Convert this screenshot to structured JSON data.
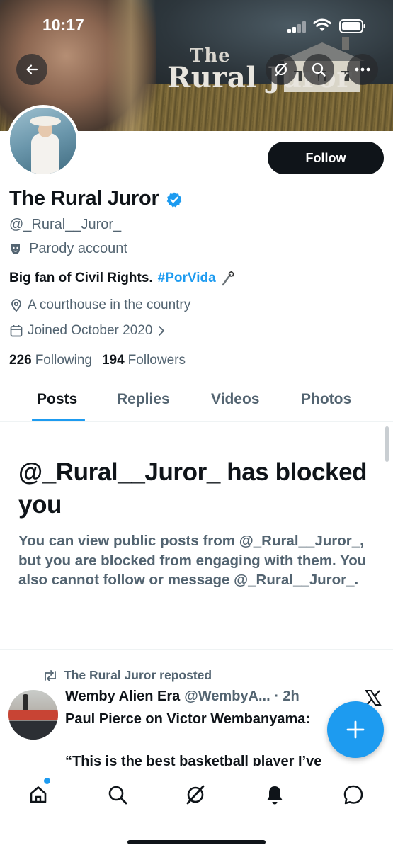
{
  "status_bar": {
    "time": "10:17"
  },
  "banner": {
    "title_line1": "The",
    "title_line2": "Rural Juror"
  },
  "profile": {
    "name": "The Rural Juror",
    "handle": "@_Rural__Juror_",
    "parody_label": "Parody account",
    "bio_text": "Big fan of Civil Rights.",
    "bio_hashtag": "#PorVida",
    "location": "A courthouse in the country",
    "joined": "Joined October 2020",
    "following_count": "226",
    "following_label": "Following",
    "followers_count": "194",
    "followers_label": "Followers",
    "follow_button": "Follow"
  },
  "tabs": [
    "Posts",
    "Replies",
    "Videos",
    "Photos"
  ],
  "blocked": {
    "title": "@_Rural__Juror_ has blocked you",
    "description": "You can view public posts from @_Rural__Juror_, but you are blocked from engaging with them. You also cannot follow or message @_Rural__Juror_."
  },
  "tweet": {
    "repost_label": "The Rural Juror reposted",
    "author_name": "Wemby Alien Era",
    "author_meta": "@WembyA... · 2h",
    "text_line1": "Paul Pierce on Victor Wembanyama:",
    "text_line2": "“This is the best basketball player I’ve"
  },
  "colors": {
    "accent": "#1d9bf0",
    "text_primary": "#0f1419",
    "text_secondary": "#536471"
  },
  "icons": {
    "nav": [
      "home-icon",
      "search-icon",
      "grok-icon",
      "notifications-icon",
      "messages-icon"
    ]
  }
}
